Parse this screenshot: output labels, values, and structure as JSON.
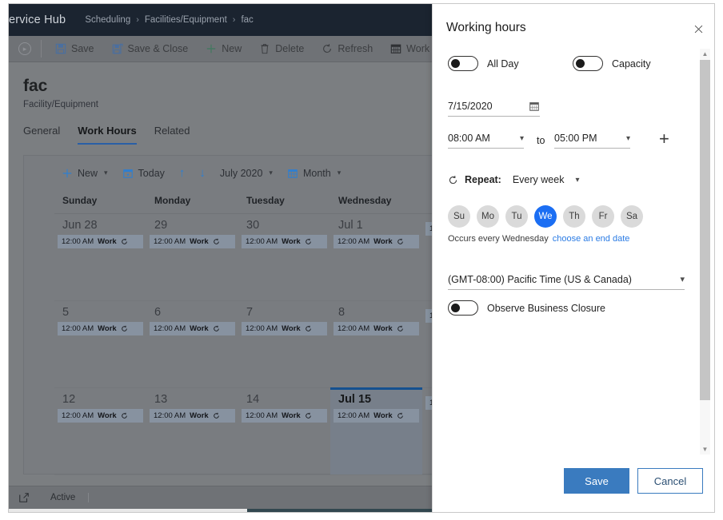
{
  "app": {
    "hub_title": "ervice Hub",
    "breadcrumb": [
      {
        "label": "Scheduling"
      },
      {
        "label": "Facilities/Equipment"
      },
      {
        "label": "fac"
      }
    ],
    "breadcrumb_separator": "›"
  },
  "command_bar": {
    "expand_icon": "chevron-right-circle-icon",
    "items": [
      {
        "label": "Save",
        "icon": "save-icon"
      },
      {
        "label": "Save & Close",
        "icon": "save-and-close-icon"
      },
      {
        "label": "New",
        "icon": "plus-icon"
      },
      {
        "label": "Delete",
        "icon": "trash-icon"
      },
      {
        "label": "Refresh",
        "icon": "refresh-icon"
      },
      {
        "label": "Work H",
        "icon": "work-hours-icon"
      }
    ]
  },
  "record": {
    "title": "fac",
    "subtitle": "Facility/Equipment",
    "tabs": [
      {
        "label": "General",
        "active": false
      },
      {
        "label": "Work Hours",
        "active": true
      },
      {
        "label": "Related",
        "active": false
      }
    ]
  },
  "calendar": {
    "toolbar": {
      "new_label": "New",
      "today_label": "Today",
      "prev_label": "↑",
      "next_label": "↓",
      "period_label": "July 2020",
      "view_label": "Month"
    },
    "day_headers": [
      "Sunday",
      "Monday",
      "Tuesday",
      "Wednesday"
    ],
    "event_time": "12:00 AM",
    "event_title": "Work",
    "weeks": [
      [
        {
          "date": "Jun 28",
          "today": false,
          "has_event": true
        },
        {
          "date": "29",
          "today": false,
          "has_event": true
        },
        {
          "date": "30",
          "today": false,
          "has_event": true
        },
        {
          "date": "Jul 1",
          "today": false,
          "has_event": true
        },
        {
          "date": "",
          "today": false,
          "has_event": true
        }
      ],
      [
        {
          "date": "5",
          "today": false,
          "has_event": true
        },
        {
          "date": "6",
          "today": false,
          "has_event": true
        },
        {
          "date": "7",
          "today": false,
          "has_event": true
        },
        {
          "date": "8",
          "today": false,
          "has_event": true
        },
        {
          "date": "",
          "today": false,
          "has_event": true
        }
      ],
      [
        {
          "date": "12",
          "today": false,
          "has_event": true
        },
        {
          "date": "13",
          "today": false,
          "has_event": true
        },
        {
          "date": "14",
          "today": false,
          "has_event": true
        },
        {
          "date": "Jul 15",
          "today": true,
          "has_event": true
        },
        {
          "date": "",
          "today": false,
          "has_event": true
        }
      ]
    ]
  },
  "status_bar": {
    "state_label": "Active",
    "popout_icon": "popout-icon"
  },
  "panel": {
    "title": "Working hours",
    "close_icon": "close-icon",
    "all_day": {
      "label": "All Day",
      "on": false
    },
    "capacity": {
      "label": "Capacity",
      "on": false
    },
    "date": {
      "value": "7/15/2020",
      "icon": "calendar-icon"
    },
    "start_time": "08:00 AM",
    "to_label": "to",
    "end_time": "05:00 PM",
    "add_icon": "plus-icon",
    "repeat": {
      "icon": "repeat-icon",
      "label": "Repeat:",
      "value": "Every week"
    },
    "days": [
      {
        "label": "Su",
        "selected": false
      },
      {
        "label": "Mo",
        "selected": false
      },
      {
        "label": "Tu",
        "selected": false
      },
      {
        "label": "We",
        "selected": true
      },
      {
        "label": "Th",
        "selected": false
      },
      {
        "label": "Fr",
        "selected": false
      },
      {
        "label": "Sa",
        "selected": false
      }
    ],
    "occurs_text": "Occurs every Wednesday",
    "end_date_link": "choose an end date",
    "timezone": "(GMT-08:00) Pacific Time (US & Canada)",
    "business_closure": {
      "label": "Observe Business Closure",
      "on": false
    },
    "save_label": "Save",
    "cancel_label": "Cancel"
  },
  "colors": {
    "accent_blue": "#1b6ef3",
    "primary_button": "#3a7bbf",
    "link": "#2a7be4",
    "topbar": "#1b2430",
    "taskbar_accent": "#c0762a"
  }
}
